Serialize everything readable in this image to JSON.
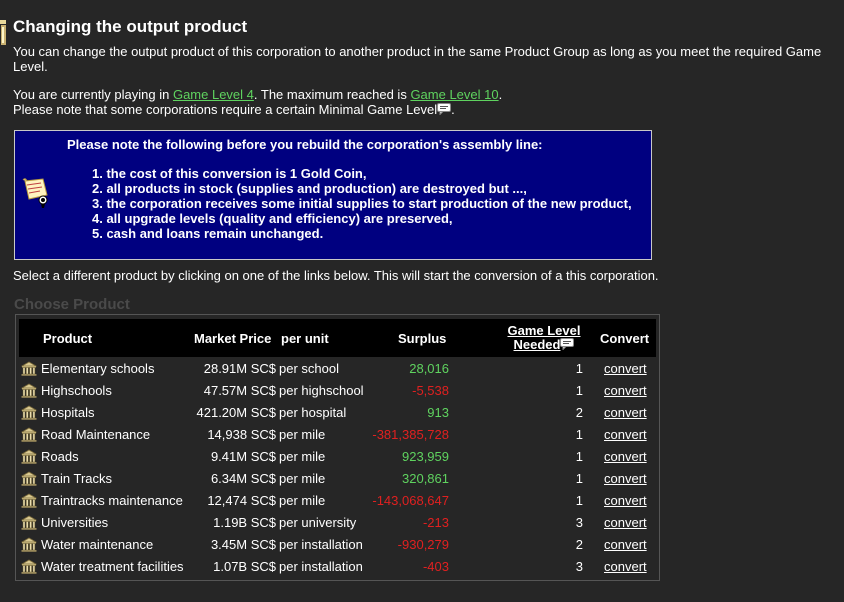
{
  "header": {
    "title": "Changing the output product"
  },
  "intro": {
    "text": "You can change the output product of this corporation to another product in the same Product Group as long as you meet the required Game Level."
  },
  "level_info": {
    "prefix": "You are currently playing in ",
    "current_level_link": "Game Level 4",
    "middle": ". The maximum reached is ",
    "max_level_link": "Game Level 10",
    "suffix": ".",
    "note": "Please note that some corporations require a certain Minimal Game Level",
    "note_end": "."
  },
  "notice": {
    "title": "Please note the following before you rebuild the corporation's assembly line:",
    "items": [
      "1. the cost of this conversion is 1 Gold Coin,",
      "2. all products in stock (supplies and production) are destroyed but ...,",
      "3. the corporation receives some initial supplies to start production of the new product,",
      "4. all upgrade levels (quality and efficiency) are preserved,",
      "5. cash and loans remain unchanged."
    ]
  },
  "select_text": "Select a different product by clicking on one of the links below. This will start the conversion of a this corporation.",
  "choose_heading": "Choose Product",
  "table": {
    "headers": {
      "product": "Product",
      "market_price": "Market Price",
      "per_unit": "per unit",
      "surplus": "Surplus",
      "game_level_line1": "Game Level",
      "game_level_line2": "Needed",
      "convert": "Convert"
    },
    "rows": [
      {
        "product": "Elementary schools",
        "price": "28.91M SC$",
        "unit": "per school",
        "surplus": "28,016",
        "level": "1",
        "convert": "convert"
      },
      {
        "product": "Highschools",
        "price": "47.57M SC$",
        "unit": "per highschool",
        "surplus": "-5,538",
        "level": "1",
        "convert": "convert"
      },
      {
        "product": "Hospitals",
        "price": "421.20M SC$",
        "unit": "per hospital",
        "surplus": "913",
        "level": "2",
        "convert": "convert"
      },
      {
        "product": "Road Maintenance",
        "price": "14,938 SC$",
        "unit": "per mile",
        "surplus": "-381,385,728",
        "level": "1",
        "convert": "convert"
      },
      {
        "product": "Roads",
        "price": "9.41M SC$",
        "unit": "per mile",
        "surplus": "923,959",
        "level": "1",
        "convert": "convert"
      },
      {
        "product": "Train Tracks",
        "price": "6.34M SC$",
        "unit": "per mile",
        "surplus": "320,861",
        "level": "1",
        "convert": "convert"
      },
      {
        "product": "Traintracks maintenance",
        "price": "12,474 SC$",
        "unit": "per mile",
        "surplus": "-143,068,647",
        "level": "1",
        "convert": "convert"
      },
      {
        "product": "Universities",
        "price": "1.19B SC$",
        "unit": "per university",
        "surplus": "-213",
        "level": "3",
        "convert": "convert"
      },
      {
        "product": "Water maintenance",
        "price": "3.45M SC$",
        "unit": "per installation",
        "surplus": "-930,279",
        "level": "2",
        "convert": "convert"
      },
      {
        "product": "Water treatment facilities",
        "price": "1.07B SC$",
        "unit": "per installation",
        "surplus": "-403",
        "level": "3",
        "convert": "convert"
      }
    ]
  },
  "colors": {
    "background": "#262626",
    "link_green": "#5fd35f",
    "negative_red": "#e02020",
    "notice_blue": "#000080"
  },
  "icons": [
    "info-pin-icon",
    "chat-bubble-icon",
    "scroll-note-icon",
    "building-icon"
  ]
}
